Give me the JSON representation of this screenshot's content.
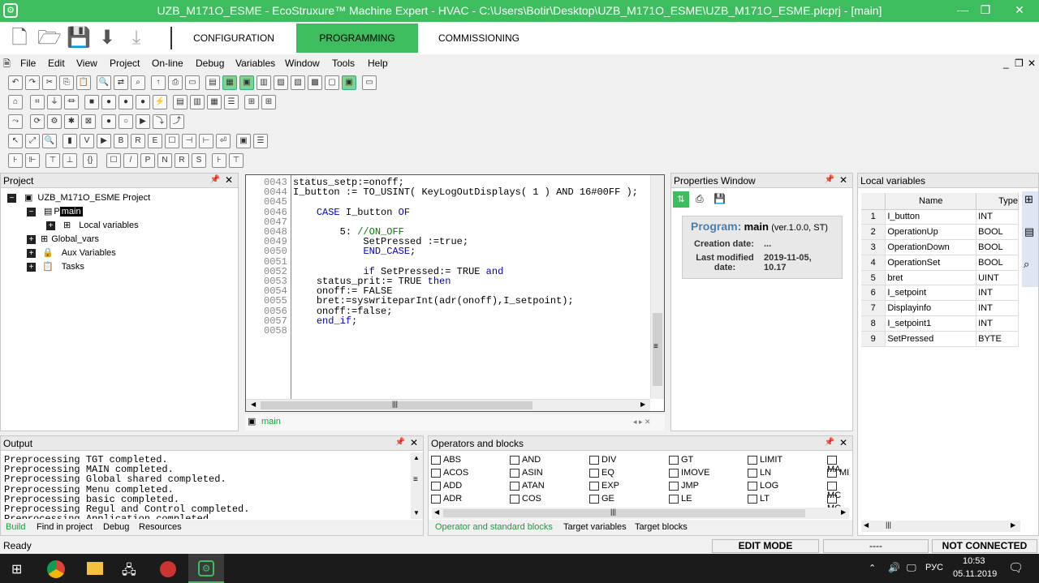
{
  "title": "UZB_M171O_ESME - EcoStruxure™ Machine Expert - HVAC - C:\\Users\\Botir\\Desktop\\UZB_M171O_ESME\\UZB_M171O_ESME.plcprj - [main]",
  "nav_tabs": [
    "CONFIGURATION",
    "PROGRAMMING",
    "COMMISSIONING"
  ],
  "menu": [
    "File",
    "Edit",
    "View",
    "Project",
    "On-line",
    "Debug",
    "Variables",
    "Window",
    "Tools",
    "Help"
  ],
  "project": {
    "header": "Project",
    "root": "UZB_M171O_ESME Project",
    "main_prefix": "P",
    "main": "main",
    "local": "Local variables",
    "global": "Global_vars",
    "aux": "Aux Variables",
    "tasks": "Tasks"
  },
  "code_lines": [
    {
      "n": "0043",
      "t": "status_setp:=onoff;"
    },
    {
      "n": "0044",
      "t": "I_button := TO_USINT( KeyLogOutDisplays( 1 ) AND 16#00FF );"
    },
    {
      "n": "0045",
      "t": ""
    },
    {
      "n": "0046",
      "t": "    CASE I_button OF"
    },
    {
      "n": "0047",
      "t": ""
    },
    {
      "n": "0048",
      "t": "        5: //ON_OFF"
    },
    {
      "n": "0049",
      "t": "            SetPressed :=true;"
    },
    {
      "n": "0050",
      "t": "            END_CASE;"
    },
    {
      "n": "0051",
      "t": ""
    },
    {
      "n": "0052",
      "t": "            if SetPressed:= TRUE and"
    },
    {
      "n": "0053",
      "t": "    status_prit:= TRUE then"
    },
    {
      "n": "0054",
      "t": "    onoff:= FALSE"
    },
    {
      "n": "0055",
      "t": "    bret:=syswriteparInt(adr(onoff),I_setpoint);"
    },
    {
      "n": "0056",
      "t": "    onoff:=false;"
    },
    {
      "n": "0057",
      "t": "    end_if;"
    },
    {
      "n": "0058",
      "t": ""
    }
  ],
  "editor_tab": "main",
  "props": {
    "header": "Properties Window",
    "program_label": "Program:",
    "program_name": "main",
    "version": "(ver.1.0.0, ST)",
    "creation_label": "Creation date:",
    "creation_value": "...",
    "modified_label": "Last modified date:",
    "modified_value": "2019-11-05, 10.17"
  },
  "locals": {
    "header": "Local variables",
    "col_name": "Name",
    "col_type": "Type",
    "rows": [
      {
        "i": "1",
        "name": "I_button",
        "type": "INT"
      },
      {
        "i": "2",
        "name": "OperationUp",
        "type": "BOOL"
      },
      {
        "i": "3",
        "name": "OperationDown",
        "type": "BOOL"
      },
      {
        "i": "4",
        "name": "OperationSet",
        "type": "BOOL"
      },
      {
        "i": "5",
        "name": "bret",
        "type": "UINT"
      },
      {
        "i": "6",
        "name": "I_setpoint",
        "type": "INT"
      },
      {
        "i": "7",
        "name": "Displayinfo",
        "type": "INT"
      },
      {
        "i": "8",
        "name": "I_setpoint1",
        "type": "INT"
      },
      {
        "i": "9",
        "name": "SetPressed",
        "type": "BYTE"
      }
    ]
  },
  "output": {
    "header": "Output",
    "lines": [
      "Preprocessing TGT completed.",
      "Preprocessing MAIN completed.",
      "Preprocessing Global shared completed.",
      "Preprocessing Menu completed.",
      "Preprocessing basic completed.",
      "Preprocessing Regul and Control completed.",
      "Preprocessing Application completed."
    ],
    "tabs": [
      "Build",
      "Find in project",
      "Debug",
      "Resources"
    ]
  },
  "operators": {
    "header": "Operators and blocks",
    "cols": [
      [
        "ABS",
        "ACOS",
        "ADD",
        "ADR"
      ],
      [
        "AND",
        "ASIN",
        "ATAN",
        "COS"
      ],
      [
        "DIV",
        "EQ",
        "EXP",
        "GE"
      ],
      [
        "GT",
        "IMOVE",
        "JMP",
        "LE"
      ],
      [
        "LIMIT",
        "LN",
        "LOG",
        "LT"
      ],
      [
        "MA",
        "MI",
        "MC",
        "MC"
      ]
    ],
    "tabs": [
      "Operator and standard blocks",
      "Target variables",
      "Target blocks"
    ]
  },
  "status": {
    "left": "Ready",
    "mode": "EDIT MODE",
    "dash": "----",
    "conn": "NOT CONNECTED"
  },
  "taskbar": {
    "lang": "РУС",
    "time": "10:53",
    "date": "05.11.2019"
  }
}
